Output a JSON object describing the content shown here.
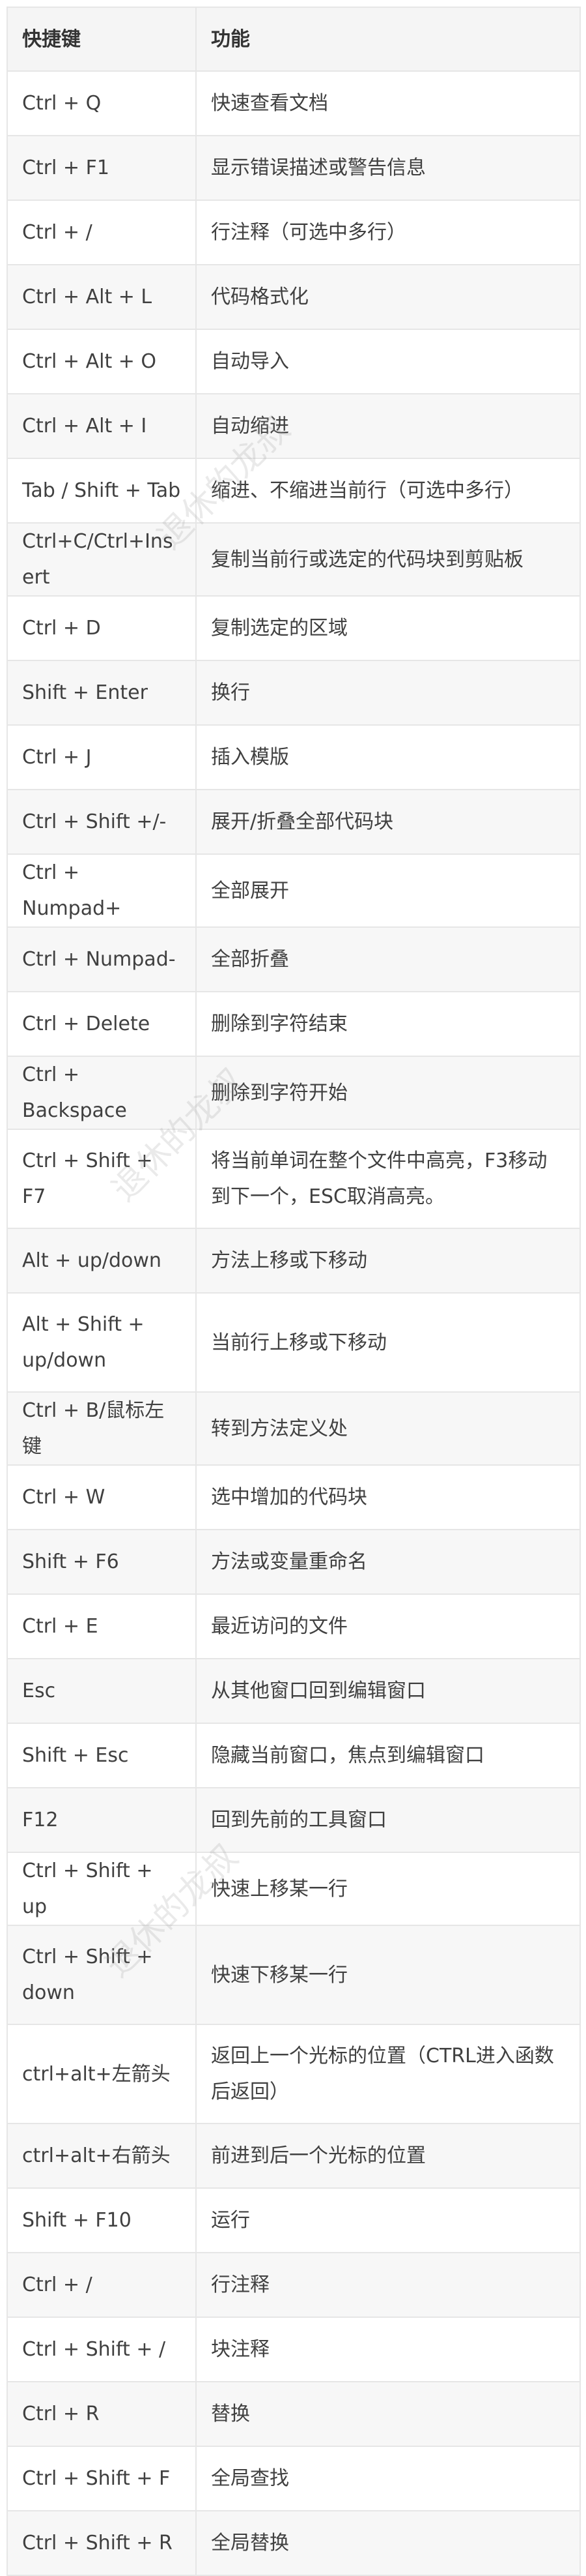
{
  "table": {
    "headers": [
      "快捷键",
      "功能"
    ],
    "rows": [
      [
        "Ctrl + Q",
        "快速查看文档"
      ],
      [
        "Ctrl + F1",
        "显示错误描述或警告信息"
      ],
      [
        "Ctrl + /",
        "行注释（可选中多行）"
      ],
      [
        "Ctrl + Alt + L",
        "代码格式化"
      ],
      [
        "Ctrl + Alt + O",
        "自动导入"
      ],
      [
        "Ctrl + Alt + I",
        "自动缩进"
      ],
      [
        "Tab / Shift + Tab",
        "缩进、不缩进当前行（可选中多行）"
      ],
      [
        "Ctrl+C/Ctrl+Insert",
        "复制当前行或选定的代码块到剪贴板"
      ],
      [
        "Ctrl + D",
        "复制选定的区域"
      ],
      [
        "Shift + Enter",
        "换行"
      ],
      [
        "Ctrl + J",
        "插入模版"
      ],
      [
        "Ctrl + Shift +/-",
        "展开/折叠全部代码块"
      ],
      [
        "Ctrl + Numpad+",
        "全部展开"
      ],
      [
        "Ctrl + Numpad-",
        "全部折叠"
      ],
      [
        "Ctrl + Delete",
        "删除到字符结束"
      ],
      [
        "Ctrl + Backspace",
        "删除到字符开始"
      ],
      [
        "Ctrl + Shift + F7",
        "将当前单词在整个文件中高亮，F3移动到下一个，ESC取消高亮。"
      ],
      [
        "Alt + up/down",
        "方法上移或下移动"
      ],
      [
        "Alt + Shift + up/down",
        "当前行上移或下移动"
      ],
      [
        "Ctrl + B/鼠标左键",
        "转到方法定义处"
      ],
      [
        "Ctrl + W",
        "选中增加的代码块"
      ],
      [
        "Shift + F6",
        "方法或变量重命名"
      ],
      [
        "Ctrl + E",
        "最近访问的文件"
      ],
      [
        "Esc",
        "从其他窗口回到编辑窗口"
      ],
      [
        "Shift + Esc",
        "隐藏当前窗口，焦点到编辑窗口"
      ],
      [
        "F12",
        "回到先前的工具窗口"
      ],
      [
        "Ctrl + Shift + up",
        "快速上移某一行"
      ],
      [
        "Ctrl + Shift + down",
        "快速下移某一行"
      ],
      [
        "ctrl+alt+左箭头",
        "返回上一个光标的位置（CTRL进入函数后返回）"
      ],
      [
        "ctrl+alt+右箭头",
        "前进到后一个光标的位置"
      ],
      [
        "Shift + F10",
        "运行"
      ],
      [
        "Ctrl + /",
        "行注释"
      ],
      [
        "Ctrl + Shift + /",
        "块注释"
      ],
      [
        "Ctrl + R",
        "替换"
      ],
      [
        "Ctrl + Shift + F",
        "全局查找"
      ],
      [
        "Ctrl + Shift + R",
        "全局替换"
      ]
    ]
  },
  "watermark": "退休的龙叔"
}
